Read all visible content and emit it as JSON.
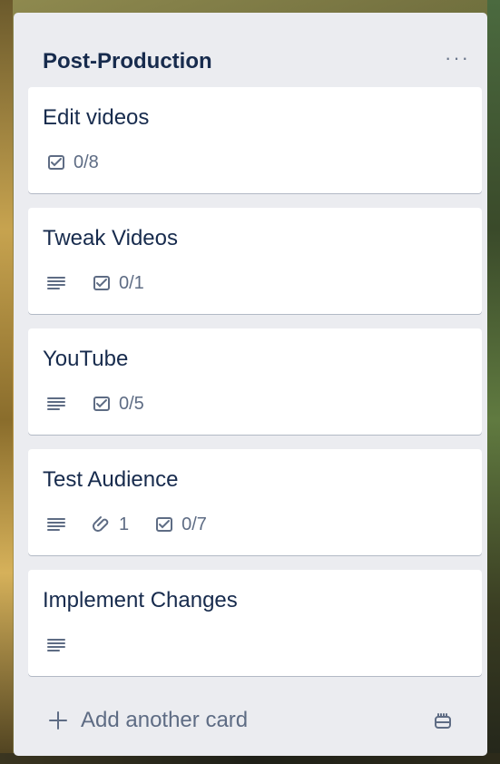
{
  "list": {
    "title": "Post-Production",
    "menu_label": "···"
  },
  "cards": [
    {
      "title": "Edit videos",
      "description": false,
      "attachments": "",
      "checklist": "0/8"
    },
    {
      "title": "Tweak Videos",
      "description": true,
      "attachments": "",
      "checklist": "0/1"
    },
    {
      "title": "YouTube",
      "description": true,
      "attachments": "",
      "checklist": "0/5"
    },
    {
      "title": "Test Audience",
      "description": true,
      "attachments": "1",
      "checklist": "0/7"
    },
    {
      "title": "Implement Changes",
      "description": true,
      "attachments": "",
      "checklist": ""
    }
  ],
  "footer": {
    "add_card_label": "Add another card",
    "template_icon": "card-template-icon"
  },
  "colors": {
    "list_bg": "#ebecf0",
    "card_bg": "#ffffff",
    "title_text": "#172b4d",
    "badge_text": "#5e6c84"
  }
}
